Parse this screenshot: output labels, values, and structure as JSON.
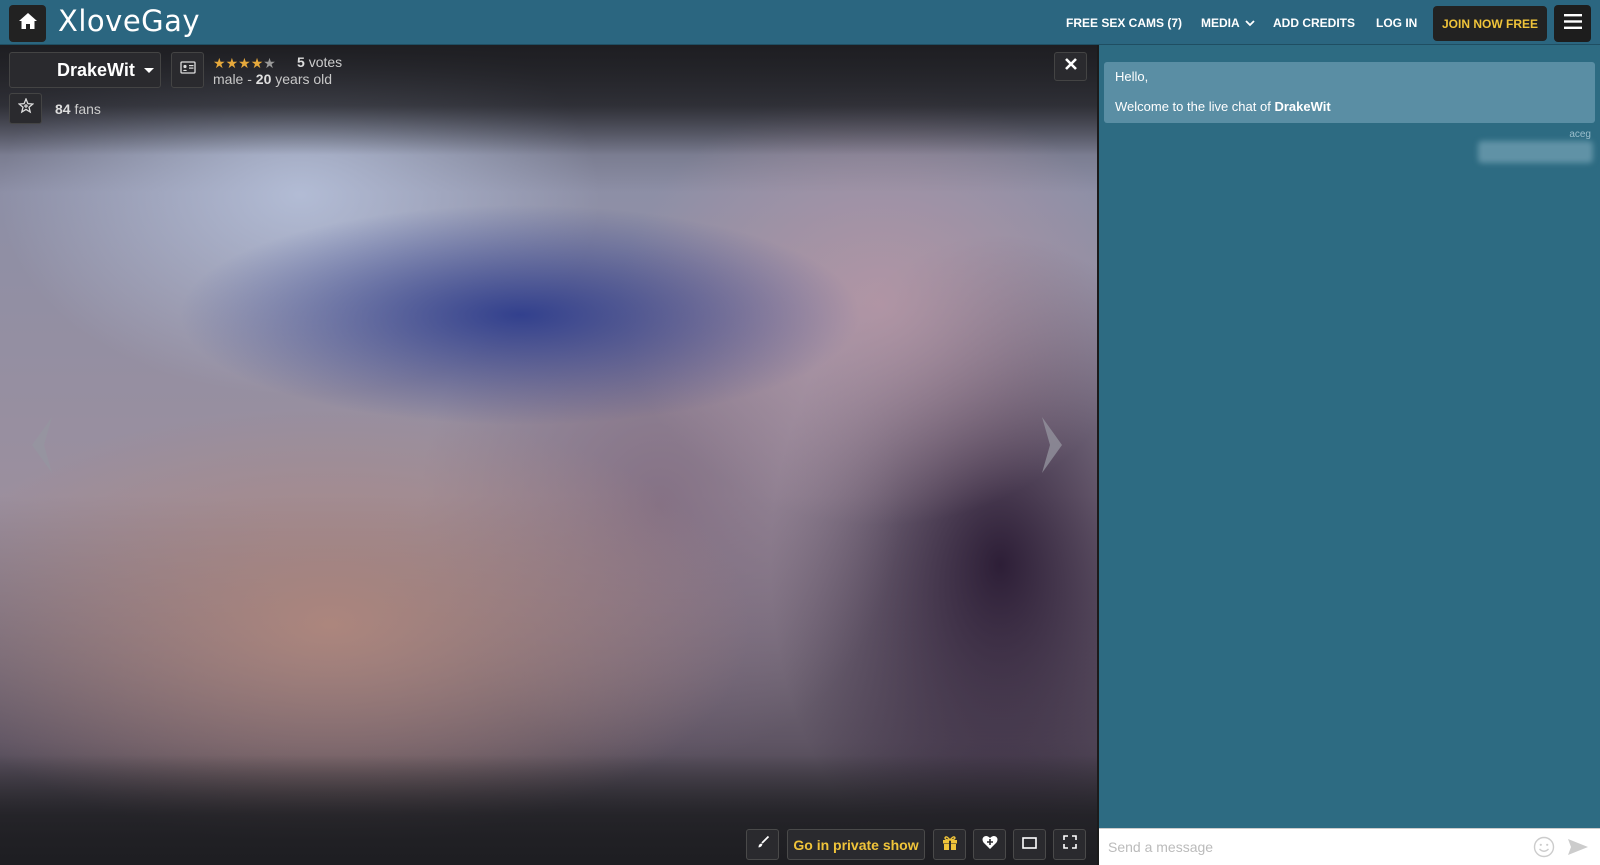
{
  "header": {
    "logo": "XloveGay",
    "nav": {
      "free_cams": "FREE SEX CAMS (7)",
      "media": "MEDIA",
      "add_credits": "ADD CREDITS",
      "log_in": "LOG IN"
    },
    "join_label": "JOIN NOW FREE"
  },
  "model": {
    "name": "DrakeWit",
    "rating_stars": 4.5,
    "votes_count": "5",
    "votes_label": "votes",
    "gender": "male -",
    "age": "20",
    "age_label": "years old",
    "fans_count": "84",
    "fans_label": "fans"
  },
  "toolbar": {
    "private_show_label": "Go in private show"
  },
  "chat": {
    "greeting": "Hello,",
    "welcome_prefix": "Welcome to the live chat of",
    "welcome_name": "DrakeWit",
    "last_user": "aceg",
    "input_placeholder": "Send a message"
  },
  "colors": {
    "header_bg": "#2b6680",
    "chat_bg": "#2d6b82",
    "accent_yellow": "#f0c43a",
    "star": "#e6a93c"
  },
  "icons": [
    "home-icon",
    "hamburger-icon",
    "chevron-down-icon",
    "profile-card-icon",
    "star-icon",
    "fan-star-icon",
    "close-icon",
    "prev-arrow-icon",
    "next-arrow-icon",
    "brush-icon",
    "gift-icon",
    "heart-icon",
    "window-icon",
    "fullscreen-icon",
    "emoji-icon",
    "send-icon"
  ]
}
